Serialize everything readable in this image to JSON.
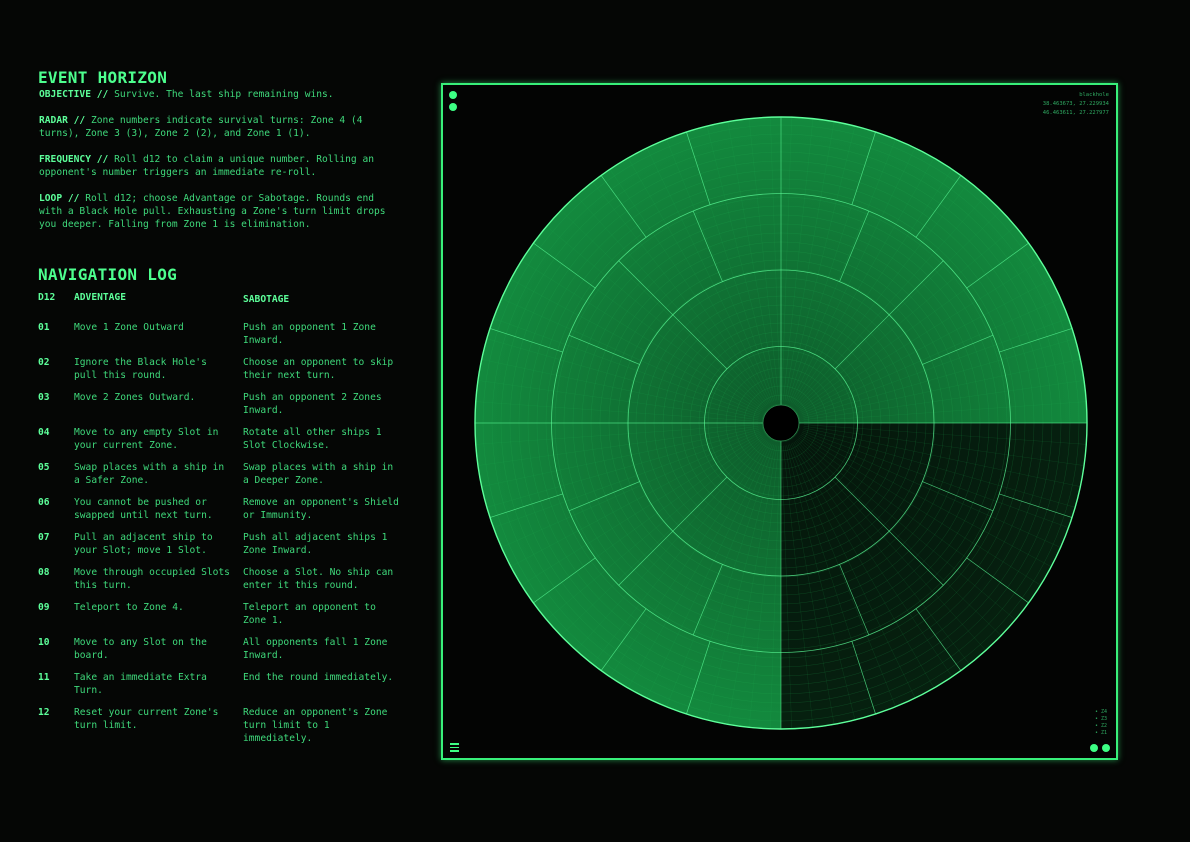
{
  "title": "EVENT HORIZON",
  "rules": [
    {
      "key": "OBJECTIVE //",
      "text": "Survive. The last ship remaining wins."
    },
    {
      "key": "RADAR //",
      "text": "Zone numbers indicate survival turns: Zone 4 (4 turns), Zone 3 (3), Zone 2 (2), and Zone 1 (1)."
    },
    {
      "key": "FREQUENCY //",
      "text": "Roll d12 to claim a unique number. Rolling an opponent's number triggers an immediate re-roll."
    },
    {
      "key": "LOOP //",
      "text": "Roll d12; choose Advantage or Sabotage. Rounds end with a Black Hole pull. Exhausting a Zone's turn limit drops you deeper. Falling from Zone 1 is elimination."
    }
  ],
  "nav_log": {
    "title": "NAVIGATION LOG",
    "headers": {
      "d12": "D12",
      "advantage": "ADVENTAGE",
      "sabotage": "SABOTAGE"
    },
    "rows": [
      {
        "n": "01",
        "adv": "Move 1 Zone Outward",
        "sab": "Push an opponent 1 Zone Inward."
      },
      {
        "n": "02",
        "adv": "Ignore the Black Hole's pull this round.",
        "sab": "Choose an opponent to skip their next turn."
      },
      {
        "n": "03",
        "adv": "Move 2 Zones Outward.",
        "sab": "Push an opponent 2 Zones Inward."
      },
      {
        "n": "04",
        "adv": "Move to any empty Slot in your current Zone.",
        "sab": "Rotate all other ships 1 Slot Clockwise."
      },
      {
        "n": "05",
        "adv": "Swap places with a ship in a Safer Zone.",
        "sab": "Swap places with a ship in a Deeper Zone."
      },
      {
        "n": "06",
        "adv": "You cannot be pushed or swapped until next turn.",
        "sab": "Remove an opponent's Shield or Immunity."
      },
      {
        "n": "07",
        "adv": "Pull an adjacent ship to your Slot; move 1 Slot.",
        "sab": "Push all adjacent ships 1 Zone Inward."
      },
      {
        "n": "08",
        "adv": "Move through occupied Slots this turn.",
        "sab": "Choose a Slot. No ship can enter it this round."
      },
      {
        "n": "09",
        "adv": "Teleport to Zone 4.",
        "sab": "Teleport an opponent to Zone 1."
      },
      {
        "n": "10",
        "adv": "Move to any Slot on the board.",
        "sab": "All opponents fall 1 Zone Inward."
      },
      {
        "n": "11",
        "adv": "Take an immediate Extra Turn.",
        "sab": "End the round immediately."
      },
      {
        "n": "12",
        "adv": "Reset your current Zone's turn limit.",
        "sab": "Reduce an opponent's Zone turn limit to 1 immediately."
      }
    ]
  },
  "radar": {
    "zones": 4,
    "zone_sectors": [
      20,
      16,
      8,
      4
    ],
    "coords": [
      "blackhole",
      "38.463673, 27.229934",
      "46.463611, 27.227977"
    ],
    "legend": [
      "• Z4",
      "• Z3",
      "• Z2",
      "• Z1"
    ],
    "accent": "#3dff84"
  }
}
